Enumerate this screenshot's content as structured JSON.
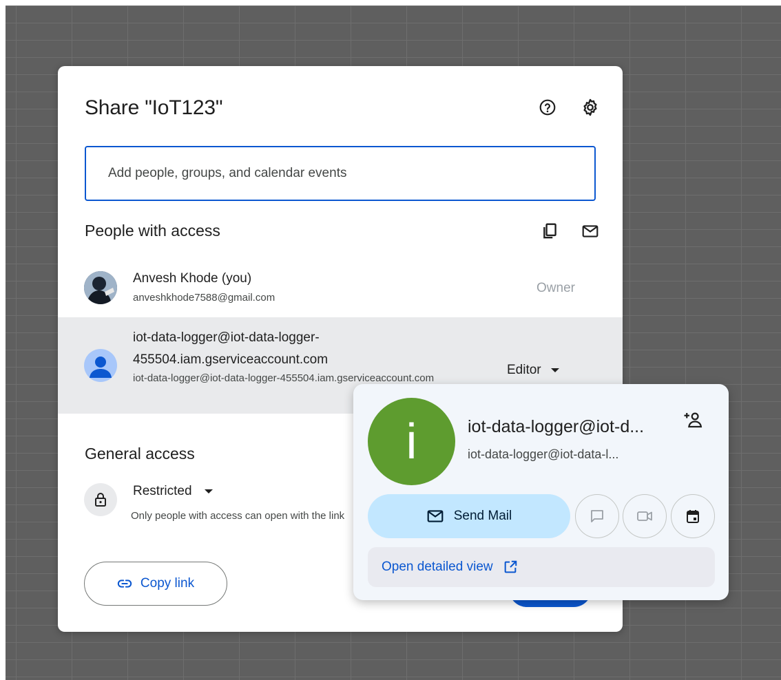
{
  "dialog": {
    "title": "Share \"IoT123\"",
    "search_placeholder": "Add people, groups, and calendar events",
    "people_title": "People with access",
    "general_title": "General access",
    "copy_link_label": "Copy link"
  },
  "people": [
    {
      "name": "Anvesh Khode (you)",
      "email": "anveshkhode7588@gmail.com",
      "role": "Owner"
    },
    {
      "name": "iot-data-logger@iot-data-logger-455504.iam.gserviceaccount.com",
      "email": "iot-data-logger@iot-data-logger-455504.iam.gserviceaccount.com",
      "role": "Editor"
    }
  ],
  "general_access": {
    "level": "Restricted",
    "description": "Only people with access can open with the link"
  },
  "hover_card": {
    "avatar_letter": "i",
    "name": "iot-data-logger@iot-d...",
    "email": "iot-data-logger@iot-data-l...",
    "send_mail_label": "Send Mail",
    "detailed_view_label": "Open detailed view"
  },
  "colors": {
    "accent": "#0b57d0",
    "card_avatar": "#5e9c2f",
    "send_mail_bg": "#c2e7ff"
  }
}
